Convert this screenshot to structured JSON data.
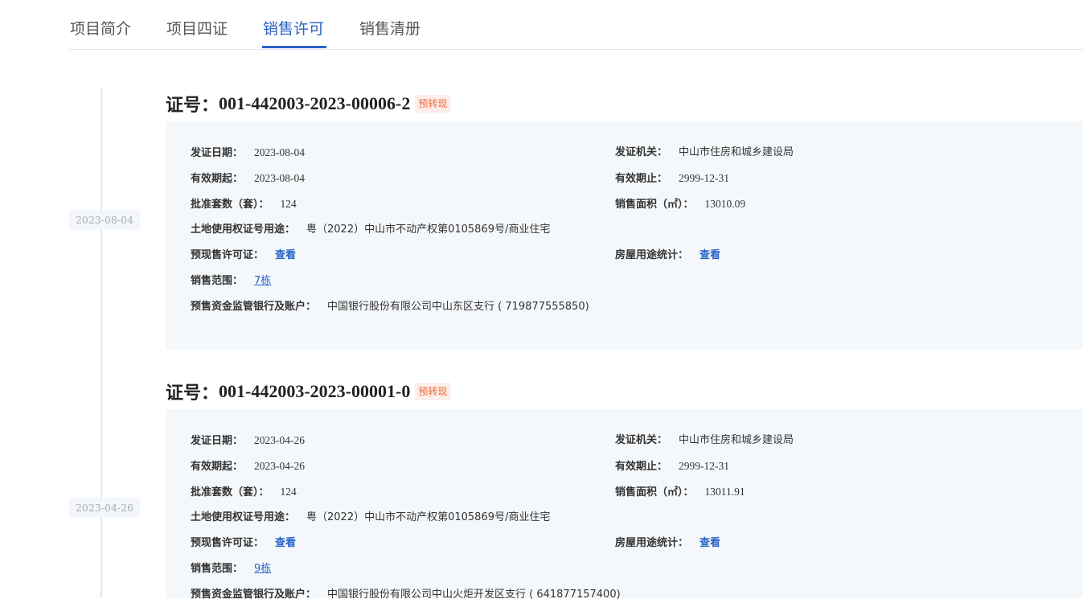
{
  "tabs": [
    {
      "label": "项目简介"
    },
    {
      "label": "项目四证"
    },
    {
      "label": "销售许可"
    },
    {
      "label": "销售清册"
    }
  ],
  "labels": {
    "cert_prefix": "证号：",
    "issue_date": "发证日期：",
    "issuer": "发证机关：",
    "valid_from": "有效期起：",
    "valid_to": "有效期止：",
    "approved_units": "批准套数（套）：",
    "sales_area": "销售面积（㎡）：",
    "land_cert": "土地使用权证号用途：",
    "presale_permit": "预现售许可证：",
    "usage_stats": "房屋用途统计：",
    "sales_scope": "销售范围：",
    "bank_account": "预售资金监管银行及账户："
  },
  "certs": [
    {
      "date": "2023-08-04",
      "number": "001-442003-2023-00006-2",
      "tag": "预转现",
      "issue_date": "2023-08-04",
      "issuer": "中山市住房和城乡建设局",
      "valid_from": "2023-08-04",
      "valid_to": "2999-12-31",
      "approved_units": "124",
      "sales_area": "13010.09",
      "land_cert": "粤（2022）中山市不动产权第0105869号/商业住宅",
      "presale_permit_link": "查看",
      "usage_stats_link": "查看",
      "sales_scope": "7栋",
      "bank_account": "中国银行股份有限公司中山东区支行 ( 719877555850)"
    },
    {
      "date": "2023-04-26",
      "number": "001-442003-2023-00001-0",
      "tag": "预转现",
      "issue_date": "2023-04-26",
      "issuer": "中山市住房和城乡建设局",
      "valid_from": "2023-04-26",
      "valid_to": "2999-12-31",
      "approved_units": "124",
      "sales_area": "13011.91",
      "land_cert": "粤（2022）中山市不动产权第0105869号/商业住宅",
      "presale_permit_link": "查看",
      "usage_stats_link": "查看",
      "sales_scope": "9栋",
      "bank_account": "中国银行股份有限公司中山火炬开发区支行 ( 641877157400)"
    }
  ],
  "colors": {
    "accent": "#2b63c6",
    "tag_text": "#ee6a3d",
    "tag_bg": "#fdeee8",
    "card_bg": "#f5f8fb"
  }
}
